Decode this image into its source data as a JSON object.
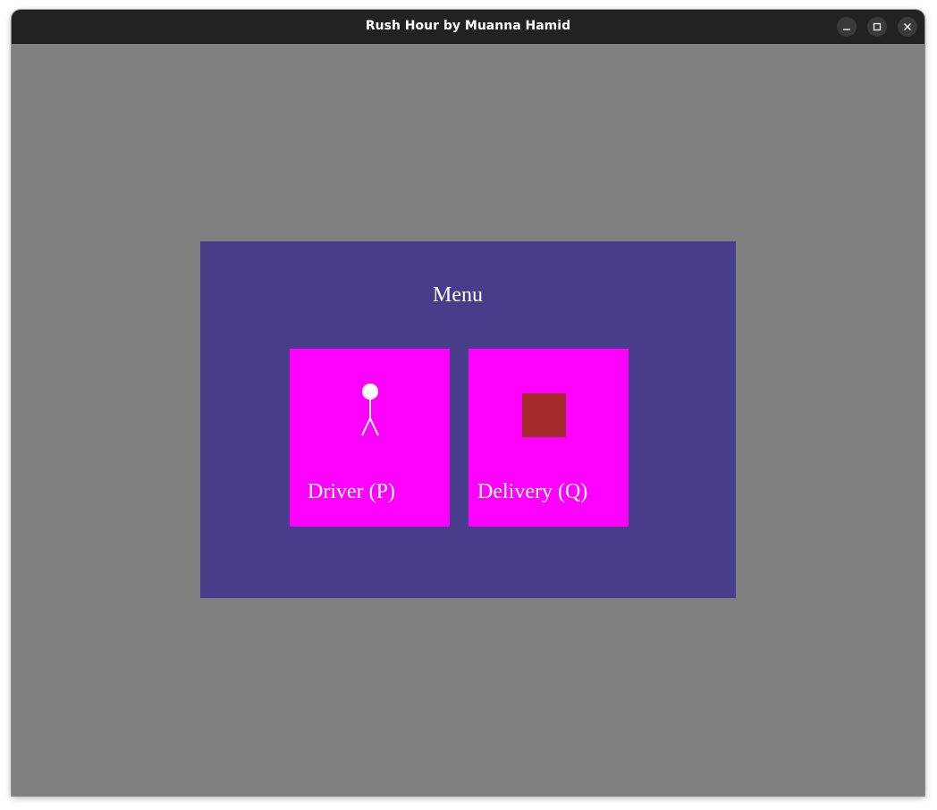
{
  "window": {
    "title": "Rush Hour by Muanna Hamid",
    "controls": [
      "minimize-icon",
      "maximize-icon",
      "close-icon"
    ]
  },
  "menu": {
    "title": "Menu",
    "options": [
      {
        "label": "Driver (P)",
        "icon": "stick-figure-icon",
        "key": "P"
      },
      {
        "label": "Delivery (Q)",
        "icon": "package-icon",
        "key": "Q"
      }
    ]
  },
  "colors": {
    "background": "#808080",
    "panel": "#483d8b",
    "option_card": "#ff00ff",
    "package": "#a52a2a",
    "text": "#ffffff"
  }
}
